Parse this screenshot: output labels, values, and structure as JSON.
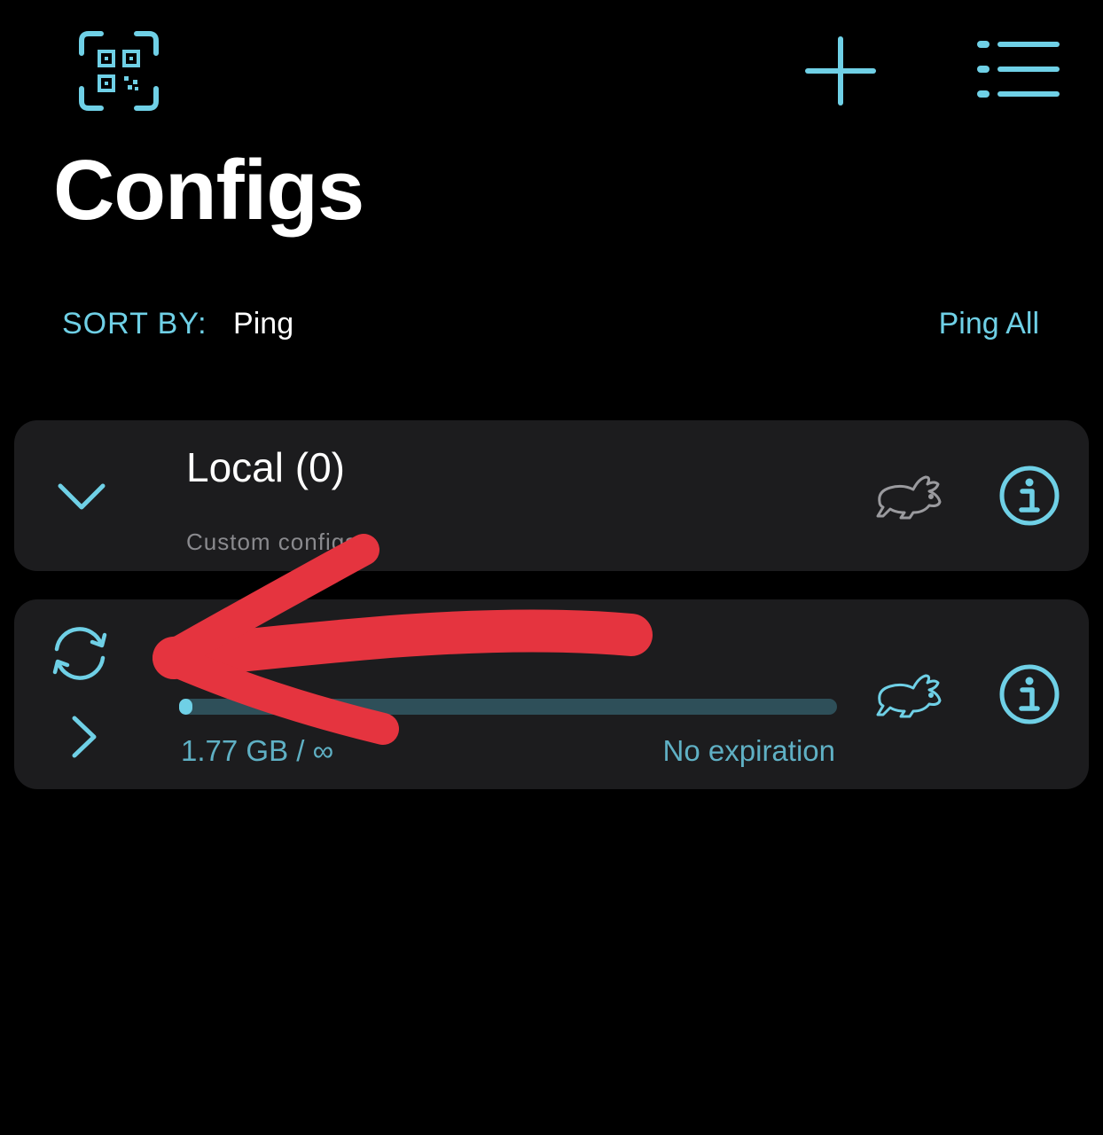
{
  "header": {
    "title": "Configs",
    "icons": [
      "qr-code-scan-icon",
      "plus-icon",
      "list-menu-icon"
    ]
  },
  "sort": {
    "label": "SORT BY:",
    "value": "Ping",
    "ping_all_label": "Ping All"
  },
  "groups": [
    {
      "name": "Local (0)",
      "description": "Custom configs",
      "expanded": true,
      "icons": [
        "chevron-down-icon",
        "rabbit-icon",
        "info-icon"
      ]
    },
    {
      "usage_label": "1.77 GB / ∞",
      "expiration_label": "No expiration",
      "usage_fraction": 0.01,
      "expanded": false,
      "icons": [
        "refresh-icon",
        "chevron-right-icon",
        "rabbit-icon",
        "info-icon"
      ]
    }
  ],
  "colors": {
    "accent": "#6fd0e6",
    "background": "#000000",
    "card": "#1c1c1e",
    "annotation_arrow": "#e5343f"
  }
}
